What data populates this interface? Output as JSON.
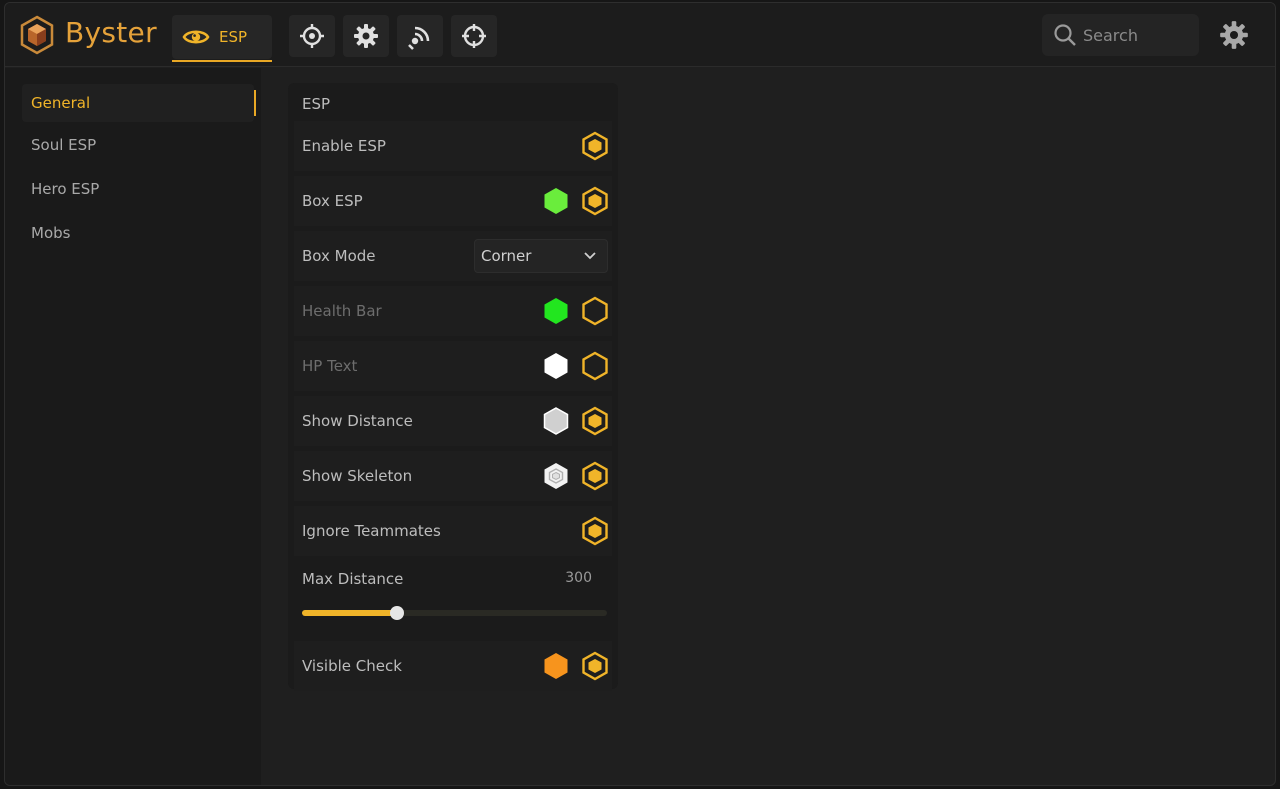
{
  "app": {
    "brand": "Byster"
  },
  "tabs": [
    {
      "label": "ESP",
      "icon": "eye-icon",
      "active": true
    },
    {
      "icon": "crosshair-dot-icon"
    },
    {
      "icon": "gear-icon"
    },
    {
      "icon": "signal-icon"
    },
    {
      "icon": "target-icon"
    }
  ],
  "search": {
    "placeholder": "Search"
  },
  "sidebar": {
    "items": [
      {
        "label": "General",
        "active": true
      },
      {
        "label": "Soul ESP"
      },
      {
        "label": "Hero ESP"
      },
      {
        "label": "Mobs"
      }
    ]
  },
  "panel": {
    "title": "ESP",
    "rows": [
      {
        "label": "Enable ESP",
        "toggle": "on"
      },
      {
        "label": "Box ESP",
        "color": "#6aed3c",
        "toggle": "on"
      },
      {
        "label": "Box Mode",
        "dropdown": "Corner"
      },
      {
        "label": "Health Bar",
        "color": "#22e61f",
        "toggle": "off",
        "dim": true
      },
      {
        "label": "HP Text",
        "color": "#ffffff",
        "toggle": "off",
        "dim": true
      },
      {
        "label": "Show Distance",
        "color": "#d0d0d0",
        "toggle": "on"
      },
      {
        "label": "Show Skeleton",
        "color": "#f2f2f2",
        "toggle": "on"
      },
      {
        "label": "Ignore Teammates",
        "toggle": "on"
      },
      {
        "label": "Visible Check",
        "color": "#f7941d",
        "toggle": "on"
      }
    ],
    "slider": {
      "label": "Max Distance",
      "value": "300",
      "fraction": 0.31
    }
  },
  "colors": {
    "accent": "#f0b429"
  }
}
